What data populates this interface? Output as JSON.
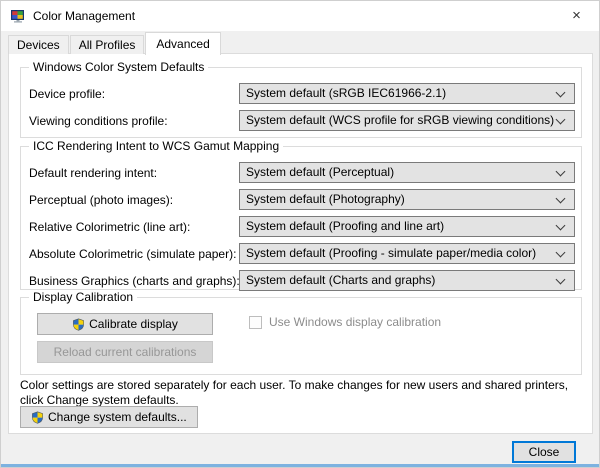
{
  "window": {
    "title": "Color Management",
    "close_glyph": "×"
  },
  "icons": {
    "title_icon": "color-management-monitor-icon",
    "shield_icon": "uac-shield-icon",
    "close_icon": "close-icon",
    "chevron_icon": "chevron-down-icon"
  },
  "tabs": [
    {
      "label": "Devices",
      "active": false
    },
    {
      "label": "All Profiles",
      "active": false
    },
    {
      "label": "Advanced",
      "active": true
    }
  ],
  "wcs_group": {
    "title": "Windows Color System Defaults",
    "rows": [
      {
        "label": "Device profile:",
        "value": "System default (sRGB IEC61966-2.1)"
      },
      {
        "label": "Viewing conditions profile:",
        "value": "System default (WCS profile for sRGB viewing conditions)"
      }
    ]
  },
  "icc_group": {
    "title": "ICC Rendering Intent to WCS Gamut Mapping",
    "rows": [
      {
        "label": "Default rendering intent:",
        "value": "System default (Perceptual)"
      },
      {
        "label": "Perceptual (photo images):",
        "value": "System default (Photography)"
      },
      {
        "label": "Relative Colorimetric (line art):",
        "value": "System default (Proofing and line art)"
      },
      {
        "label": "Absolute Colorimetric (simulate paper):",
        "value": "System default (Proofing - simulate paper/media color)"
      },
      {
        "label": "Business Graphics (charts and graphs):",
        "value": "System default (Charts and graphs)"
      }
    ]
  },
  "calibration_group": {
    "title": "Display Calibration",
    "calibrate_button": "Calibrate display",
    "reload_button": "Reload current calibrations",
    "checkbox_label": "Use Windows display calibration",
    "checkbox_checked": false
  },
  "note": "Color settings are stored separately for each user. To make changes for new users and shared printers, click Change system defaults.",
  "change_defaults_button": "Change system defaults...",
  "footer": {
    "close_button": "Close"
  },
  "colors": {
    "accent_blue": "#0078d7",
    "window_bottom_border": "#7db2e0",
    "shield_blue": "#2a6cc0",
    "shield_yellow": "#f5d20c",
    "dialog_bg": "#f0f0f0",
    "page_bg": "#ffffff",
    "combo_bg": "#e3e3e3"
  }
}
